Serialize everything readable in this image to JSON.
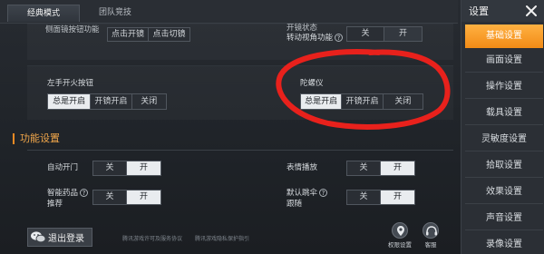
{
  "tabs": [
    {
      "label": "经典模式"
    },
    {
      "label": "团队竞技"
    }
  ],
  "top_rows": {
    "left_label": "侧面镜按钮功能",
    "left_options": [
      "点击开镜",
      "点击切镜"
    ],
    "right_label_line1": "开镜状态",
    "right_label_line2": "转动视角功能",
    "right_options": [
      "关",
      "开"
    ]
  },
  "fire_row": {
    "label": "左手开火按钮",
    "options": [
      "总是开启",
      "开镜开启",
      "关闭"
    ],
    "selected": "总是开启"
  },
  "gyro_row": {
    "label": "陀螺仪",
    "options": [
      "总是开启",
      "开镜开启",
      "关闭"
    ],
    "selected": "总是开启"
  },
  "section": {
    "title": "功能设置"
  },
  "func_rows": [
    {
      "label": "自动开门",
      "options": [
        "关",
        "开"
      ],
      "selected": "开"
    },
    {
      "label": "表情播放",
      "options": [
        "关",
        "开"
      ],
      "selected": "开"
    },
    {
      "label_line1": "智能药品",
      "label_line2": "推荐",
      "options": [
        "关",
        "开"
      ],
      "selected": "开"
    },
    {
      "label_line1": "默认跳伞",
      "label_line2": "跟随",
      "options": [
        "关",
        "开"
      ],
      "selected": "开"
    }
  ],
  "right_panel": {
    "title": "设置",
    "items": [
      {
        "label": "基础设置"
      },
      {
        "label": "画面设置"
      },
      {
        "label": "操作设置"
      },
      {
        "label": "载具设置"
      },
      {
        "label": "灵敏度设置"
      },
      {
        "label": "拾取设置"
      },
      {
        "label": "效果设置"
      },
      {
        "label": "声音设置"
      },
      {
        "label": "录像设置"
      }
    ],
    "active_index": 0
  },
  "bottom": {
    "logout_label": "退出登录",
    "footer_link_1": "腾讯游戏许可及服务协议",
    "footer_link_2": "腾讯游戏隐私保护指引",
    "icon_1_label": "权限设置",
    "icon_2_label": "客服"
  },
  "colors": {
    "accent": "#f28b16",
    "annotation": "#e8211c"
  }
}
